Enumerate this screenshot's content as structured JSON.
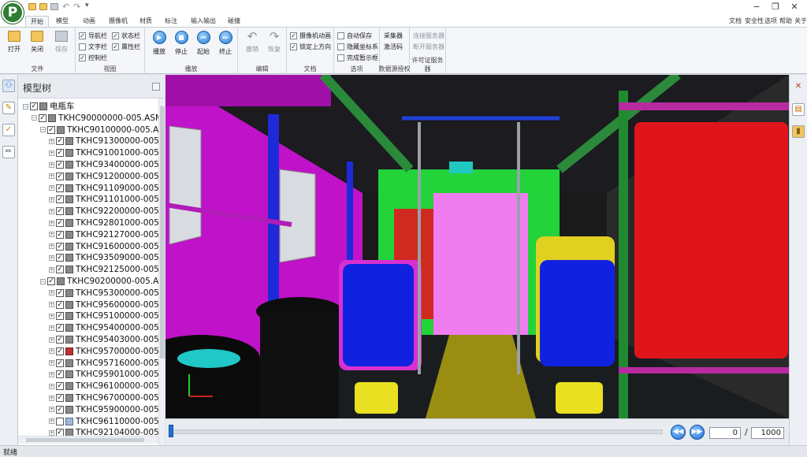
{
  "app": {
    "logo": "P"
  },
  "tabs": [
    "开始",
    "模型",
    "动画",
    "摄像机",
    "材质",
    "标注",
    "输入输出",
    "碰撞"
  ],
  "right_menu": [
    "文档",
    "安全性",
    "选项",
    "帮助",
    "关于"
  ],
  "ribbon": {
    "file": {
      "label": "文件",
      "open": "打开",
      "close": "关闭",
      "save": "保存"
    },
    "view": {
      "label": "视图",
      "checks": [
        {
          "text": "导航栏",
          "checked": true
        },
        {
          "text": "文字栏",
          "checked": false
        },
        {
          "text": "控制栏",
          "checked": true
        },
        {
          "text": "状态栏",
          "checked": true
        },
        {
          "text": "属性栏",
          "checked": true
        }
      ]
    },
    "play": {
      "label": "播放",
      "play": "播放",
      "stop": "停止",
      "rewind": "起始",
      "end": "终止"
    },
    "edit": {
      "label": "编辑",
      "undo": "撤销",
      "redo": "恢复"
    },
    "doc": {
      "label": "文档",
      "checks": [
        {
          "text": "摄像机动画",
          "checked": true
        },
        {
          "text": "锁定上方向",
          "checked": true
        }
      ]
    },
    "options": {
      "label": "选项",
      "checks": [
        {
          "text": "自动保存",
          "checked": false
        },
        {
          "text": "隐藏坐标系",
          "checked": false
        },
        {
          "text": "完成暂示框",
          "checked": false
        }
      ]
    },
    "collect": {
      "label": "数据源授权",
      "btn1": "采集器",
      "btn2": "激活码"
    },
    "license": {
      "label": "许可证服务器",
      "btn1": "连接服务器",
      "btn2": "断开服务器"
    }
  },
  "tree": {
    "title": "模型树",
    "rows": [
      {
        "indent": 0,
        "text": "电瓶车",
        "checked": true,
        "icon": "normal",
        "exp": "−"
      },
      {
        "indent": 1,
        "text": "TKHC90000000-005.ASM",
        "checked": true,
        "icon": "normal",
        "exp": "−"
      },
      {
        "indent": 2,
        "text": "TKHC90100000-005.ASM",
        "checked": true,
        "icon": "normal",
        "exp": "−"
      },
      {
        "indent": 3,
        "text": "TKHC91300000-005.A",
        "checked": true,
        "icon": "normal",
        "exp": "+"
      },
      {
        "indent": 3,
        "text": "TKHC91001000-005.A",
        "checked": true,
        "icon": "normal",
        "exp": "+"
      },
      {
        "indent": 3,
        "text": "TKHC93400000-005.A",
        "checked": true,
        "icon": "normal",
        "exp": "+"
      },
      {
        "indent": 3,
        "text": "TKHC91200000-005.A",
        "checked": true,
        "icon": "normal",
        "exp": "+"
      },
      {
        "indent": 3,
        "text": "TKHC91109000-005.A",
        "checked": true,
        "icon": "normal",
        "exp": "+"
      },
      {
        "indent": 3,
        "text": "TKHC91101000-005.A",
        "checked": true,
        "icon": "normal",
        "exp": "+"
      },
      {
        "indent": 3,
        "text": "TKHC92200000-005.A",
        "checked": true,
        "icon": "normal",
        "exp": "+"
      },
      {
        "indent": 3,
        "text": "TKHC92801000-005.A",
        "checked": true,
        "icon": "normal",
        "exp": "+"
      },
      {
        "indent": 3,
        "text": "TKHC92127000-005.A",
        "checked": true,
        "icon": "normal",
        "exp": "+"
      },
      {
        "indent": 3,
        "text": "TKHC91600000-005.A",
        "checked": true,
        "icon": "normal",
        "exp": "+"
      },
      {
        "indent": 3,
        "text": "TKHC93509000-005.A",
        "checked": true,
        "icon": "normal",
        "exp": "+"
      },
      {
        "indent": 3,
        "text": "TKHC92125000-005.A",
        "checked": true,
        "icon": "normal",
        "exp": "+"
      },
      {
        "indent": 2,
        "text": "TKHC90200000-005.ASM",
        "checked": true,
        "icon": "normal",
        "exp": "−"
      },
      {
        "indent": 3,
        "text": "TKHC95300000-005.A",
        "checked": true,
        "icon": "normal",
        "exp": "+"
      },
      {
        "indent": 3,
        "text": "TKHC95600000-005.A",
        "checked": true,
        "icon": "normal",
        "exp": "+"
      },
      {
        "indent": 3,
        "text": "TKHC95100000-005.A",
        "checked": true,
        "icon": "normal",
        "exp": "+"
      },
      {
        "indent": 3,
        "text": "TKHC95400000-005.A",
        "checked": true,
        "icon": "normal",
        "exp": "+"
      },
      {
        "indent": 3,
        "text": "TKHC95403000-005.A",
        "checked": true,
        "icon": "normal",
        "exp": "+"
      },
      {
        "indent": 3,
        "text": "TKHC95700000-005.A",
        "checked": true,
        "icon": "red",
        "exp": "+"
      },
      {
        "indent": 3,
        "text": "TKHC95716000-005.A",
        "checked": true,
        "icon": "normal",
        "exp": "+"
      },
      {
        "indent": 3,
        "text": "TKHC95901000-005.A",
        "checked": true,
        "icon": "normal",
        "exp": "+"
      },
      {
        "indent": 3,
        "text": "TKHC96100000-005.A",
        "checked": true,
        "icon": "normal",
        "exp": "+"
      },
      {
        "indent": 3,
        "text": "TKHC96700000-005.A",
        "checked": true,
        "icon": "normal",
        "exp": "+"
      },
      {
        "indent": 3,
        "text": "TKHC95900000-005.A",
        "checked": true,
        "icon": "normal",
        "exp": "+"
      },
      {
        "indent": 3,
        "text": "TKHC96110000-005.A",
        "checked": false,
        "icon": "blue",
        "exp": "+"
      },
      {
        "indent": 3,
        "text": "TKHC92104000-005.A",
        "checked": true,
        "icon": "normal",
        "exp": "+"
      }
    ]
  },
  "playback": {
    "current": "0",
    "total": "1000",
    "separator": "/",
    "progress": 0
  },
  "status": "就绪"
}
